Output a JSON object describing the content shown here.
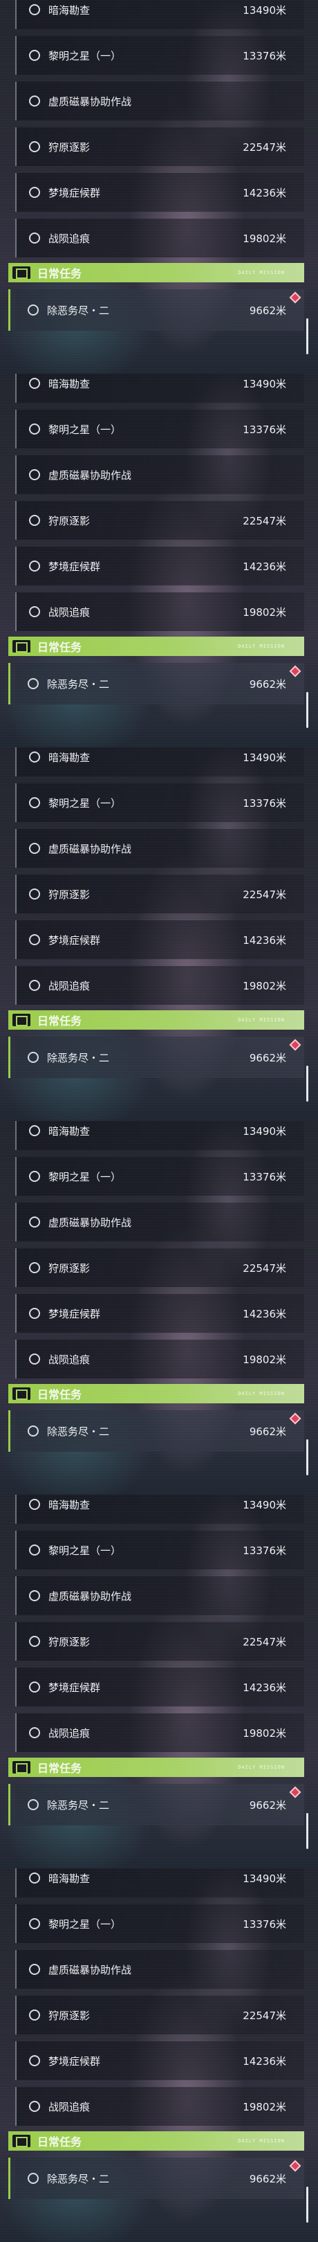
{
  "tasks": [
    {
      "name": "暗海勘查",
      "distance": "13490米"
    },
    {
      "name": "黎明之星（一）",
      "distance": "13376米"
    },
    {
      "name": "虚质磁暴协助作战",
      "distance": ""
    },
    {
      "name": "狩原逐影",
      "distance": "22547米"
    },
    {
      "name": "梦境症候群",
      "distance": "14236米"
    },
    {
      "name": "战陨追痕",
      "distance": "19802米"
    }
  ],
  "daily": {
    "title": "日常任务",
    "subtitle": "DAILY MISSION",
    "task": {
      "name": "除恶务尽・二",
      "distance": "9662米"
    }
  },
  "icons": {
    "header_icon": "book-icon",
    "marker": "tracking-diamond-icon",
    "task_status": "radio-circle-icon"
  },
  "colors": {
    "accent": "#9bcd4a",
    "marker": "#e0405a",
    "text": "#eef1f4"
  }
}
